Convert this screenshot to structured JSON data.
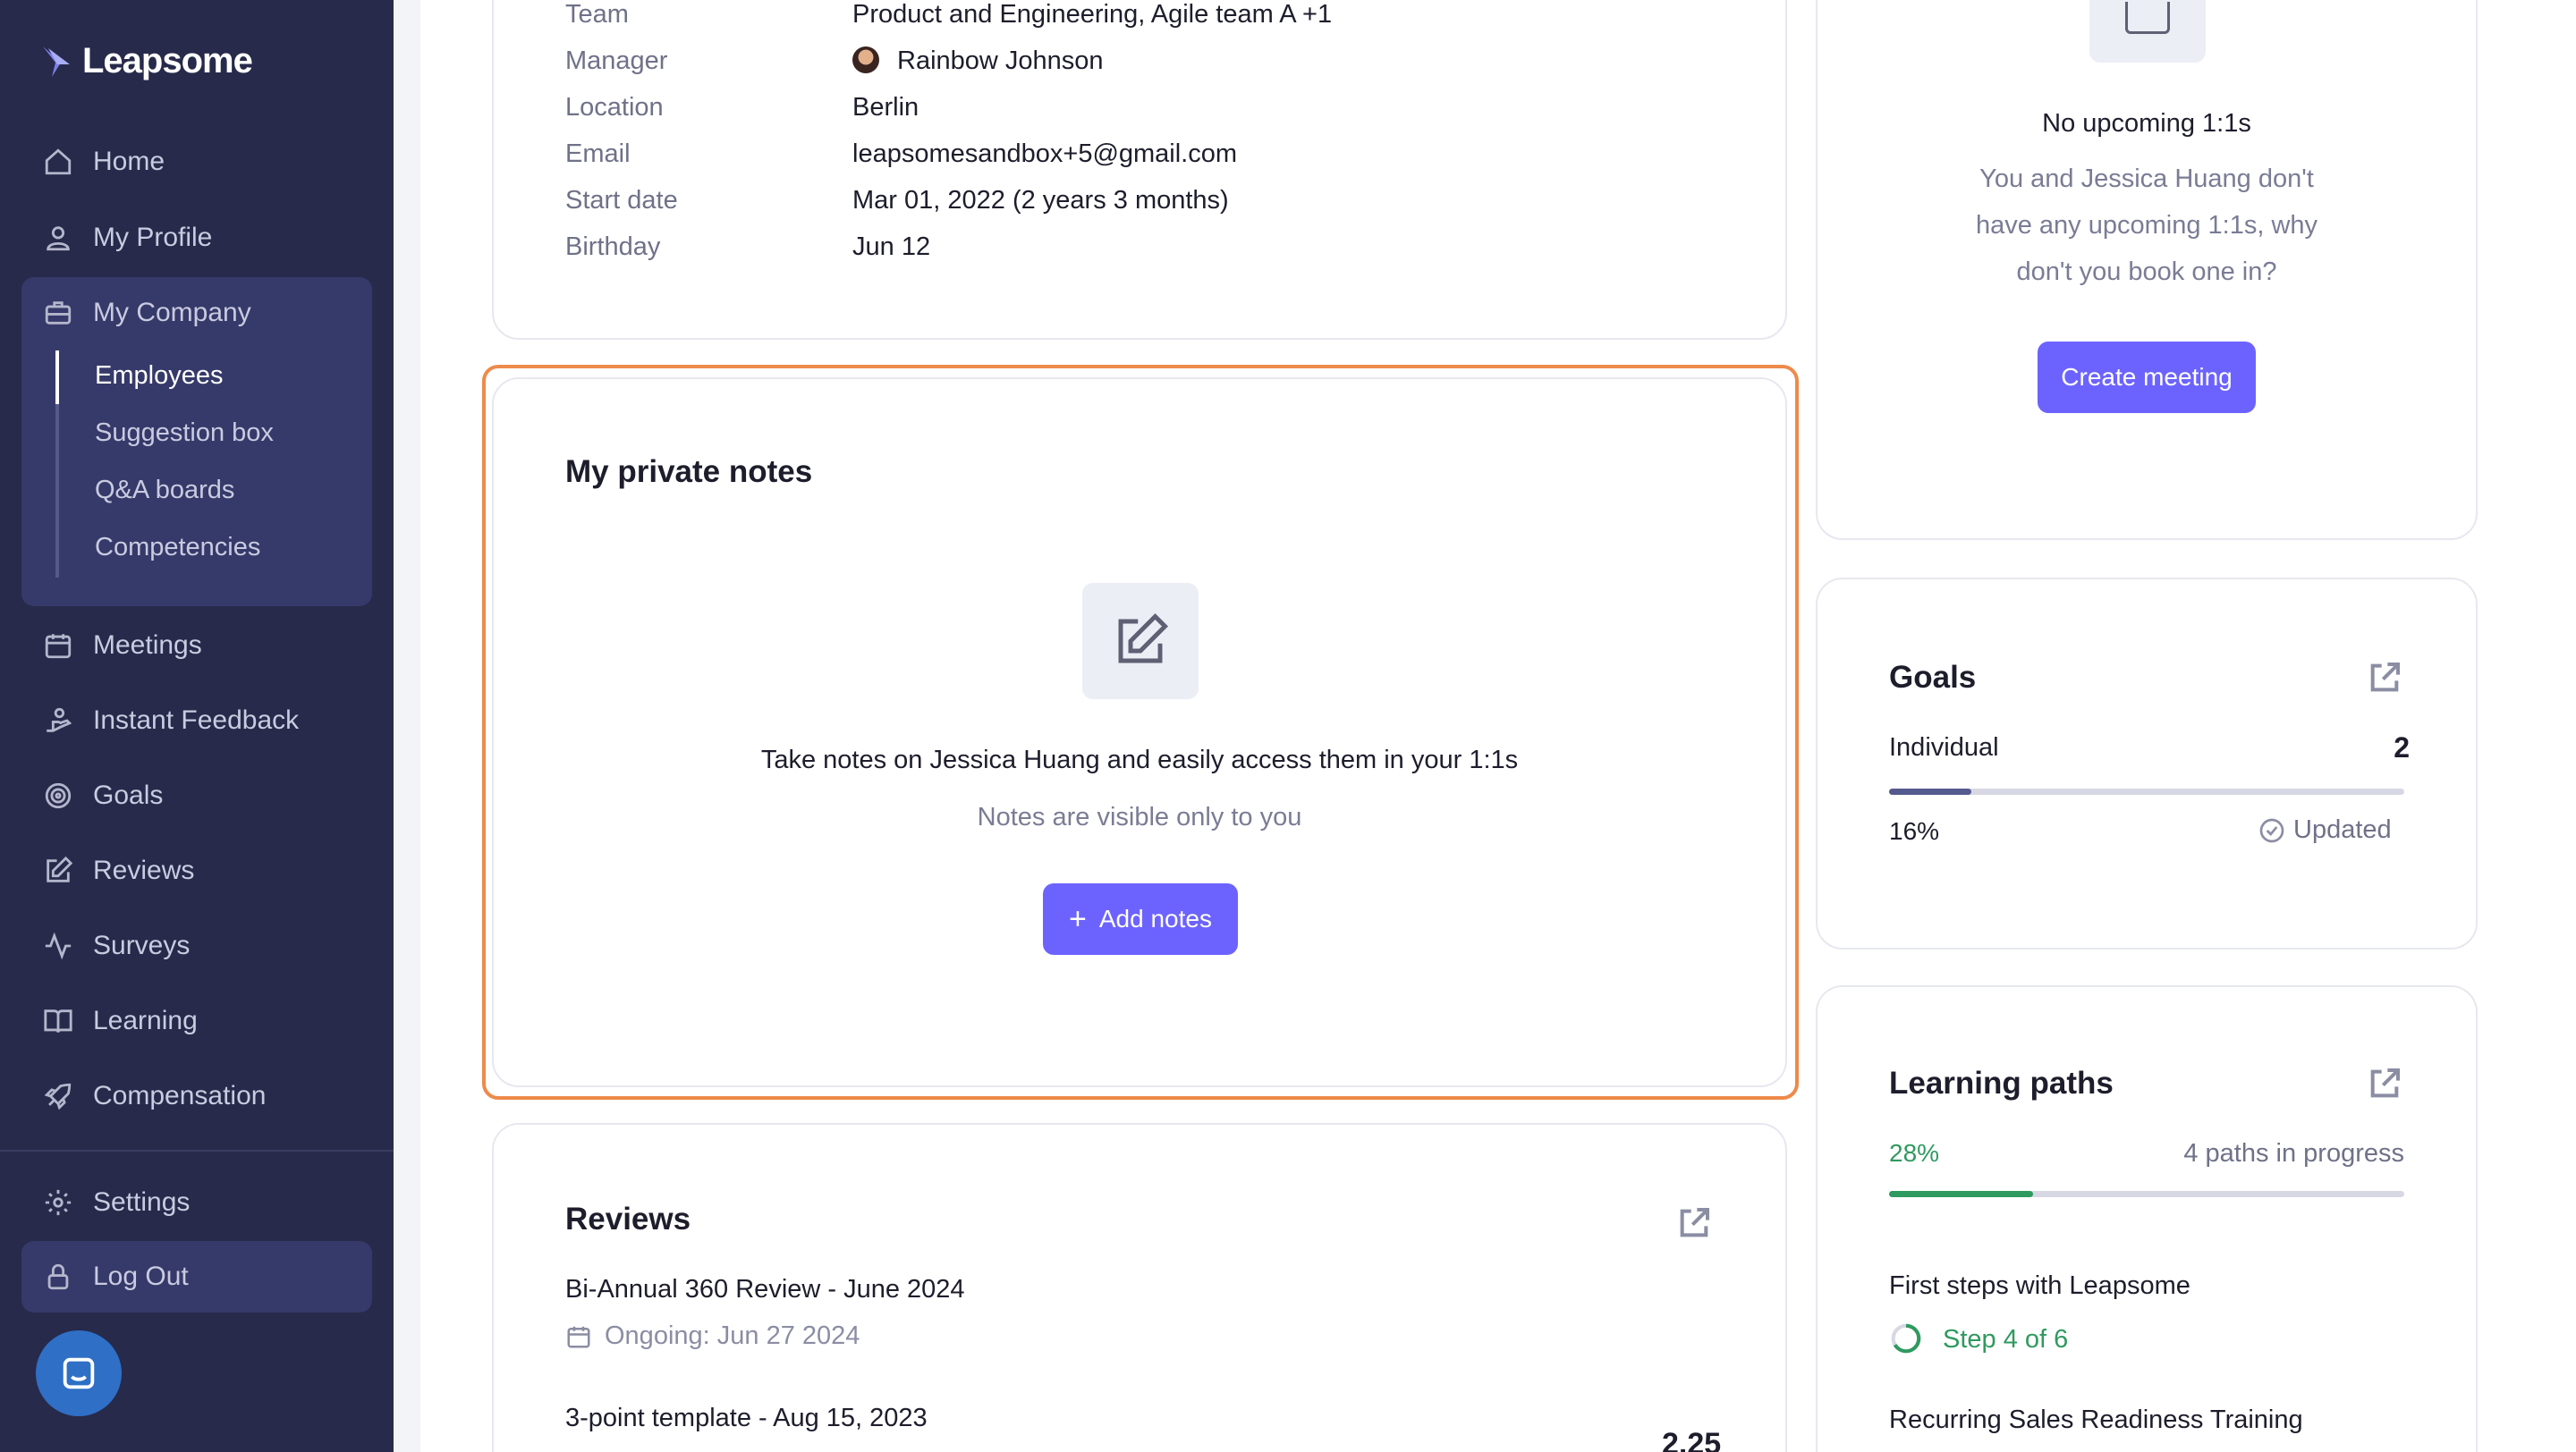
{
  "brand": {
    "name": "Leapsome"
  },
  "sidebar": {
    "items": [
      {
        "label": "Home",
        "icon": "home-icon"
      },
      {
        "label": "My Profile",
        "icon": "user-icon"
      },
      {
        "label": "My Company",
        "icon": "briefcase-icon"
      },
      {
        "label": "Meetings",
        "icon": "calendar-icon"
      },
      {
        "label": "Instant Feedback",
        "icon": "feedback-hand-icon"
      },
      {
        "label": "Goals",
        "icon": "target-icon"
      },
      {
        "label": "Reviews",
        "icon": "edit-icon"
      },
      {
        "label": "Surveys",
        "icon": "activity-icon"
      },
      {
        "label": "Learning",
        "icon": "book-icon"
      },
      {
        "label": "Compensation",
        "icon": "rocket-icon"
      }
    ],
    "company_subitems": [
      "Employees",
      "Suggestion box",
      "Q&A boards",
      "Competencies"
    ],
    "settings_label": "Settings",
    "logout_label": "Log Out"
  },
  "profile_info": {
    "rows": [
      {
        "label": "Team",
        "value": "Product and Engineering, Agile team A +1"
      },
      {
        "label": "Manager",
        "value": "Rainbow Johnson"
      },
      {
        "label": "Location",
        "value": "Berlin"
      },
      {
        "label": "Email",
        "value": "leapsomesandbox+5@gmail.com"
      },
      {
        "label": "Start date",
        "value": "Mar 01, 2022 (2 years 3 months)"
      },
      {
        "label": "Birthday",
        "value": "Jun 12"
      }
    ]
  },
  "notes": {
    "title": "My private notes",
    "description": "Take notes on Jessica Huang and easily access them in your 1:1s",
    "visibility": "Notes are visible only to you",
    "button_label": "Add notes"
  },
  "reviews": {
    "title": "Reviews",
    "items": [
      {
        "name": "Bi-Annual 360 Review - June 2024",
        "status": "Ongoing: Jun 27 2024"
      },
      {
        "name": "3-point template - Aug 15, 2023",
        "score": "2.25"
      }
    ]
  },
  "meetings": {
    "title": "No upcoming 1:1s",
    "description_lines": [
      "You and Jessica Huang don't",
      "have any upcoming 1:1s, why",
      "don't you book one in?"
    ],
    "button_label": "Create meeting"
  },
  "goals": {
    "title": "Goals",
    "individual_label": "Individual",
    "individual_count": "2",
    "progress_label": "16%",
    "progress_value": 0.16,
    "status": "Updated"
  },
  "learning": {
    "title": "Learning paths",
    "progress_label": "28%",
    "progress_value": 0.28,
    "in_progress": "4 paths in progress",
    "paths": [
      {
        "name": "First steps with Leapsome",
        "step": "Step 4 of 6"
      },
      {
        "name": "Recurring Sales Readiness Training"
      }
    ]
  },
  "colors": {
    "accent": "#6c63ff",
    "sidebar": "#272a4a",
    "highlight_border": "#ee8a4b",
    "success": "#2f9a5f"
  }
}
